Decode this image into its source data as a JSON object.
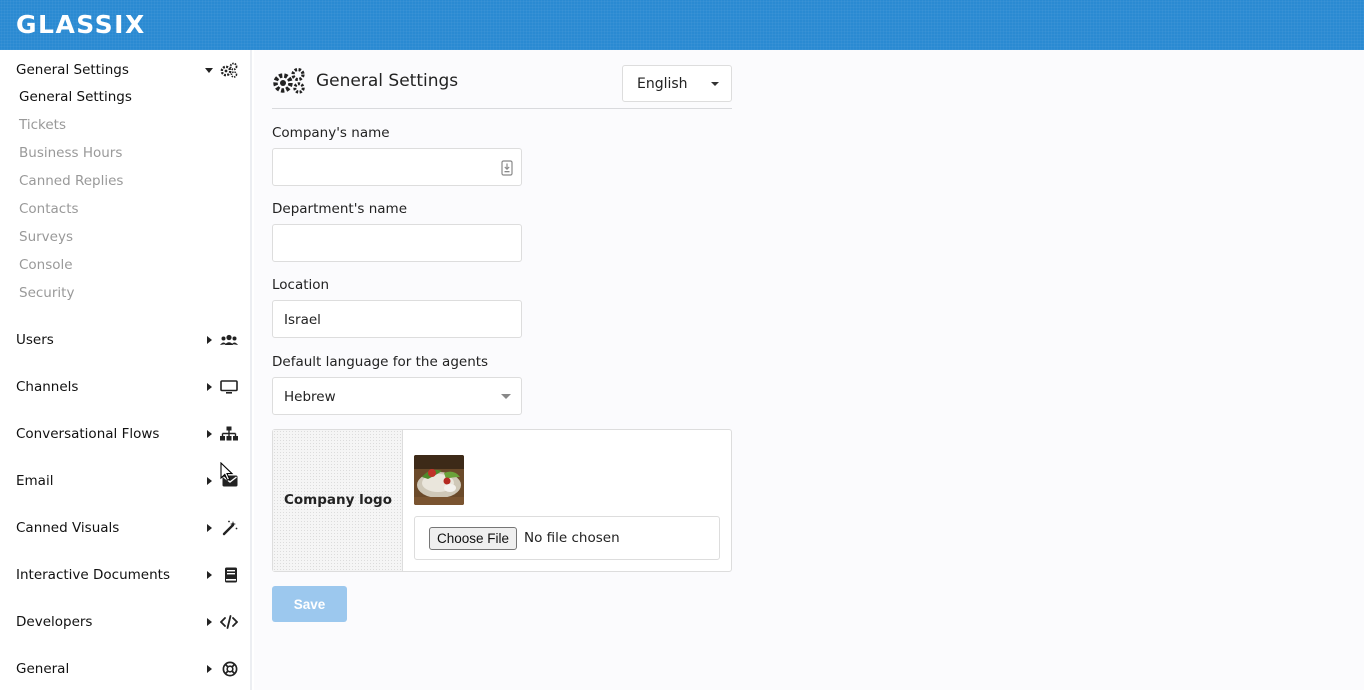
{
  "app": {
    "brand": "GLASSIX"
  },
  "sidebar": {
    "top_section": {
      "label": "General Settings",
      "icon": "gears-icon",
      "items": [
        {
          "label": "General Settings",
          "active": true
        },
        {
          "label": "Tickets"
        },
        {
          "label": "Business Hours"
        },
        {
          "label": "Canned Replies"
        },
        {
          "label": "Contacts"
        },
        {
          "label": "Surveys"
        },
        {
          "label": "Console"
        },
        {
          "label": "Security"
        }
      ]
    },
    "sections": [
      {
        "label": "Users",
        "icon": "users-icon"
      },
      {
        "label": "Channels",
        "icon": "monitor-icon"
      },
      {
        "label": "Conversational Flows",
        "icon": "sitemap-icon"
      },
      {
        "label": "Email",
        "icon": "envelope-icon"
      },
      {
        "label": "Canned Visuals",
        "icon": "magic-wand-icon"
      },
      {
        "label": "Interactive Documents",
        "icon": "book-icon"
      },
      {
        "label": "Developers",
        "icon": "code-icon"
      },
      {
        "label": "General",
        "icon": "life-ring-icon"
      }
    ]
  },
  "main": {
    "title": "General Settings",
    "language_select": {
      "value": "English"
    },
    "fields": {
      "company_name": {
        "label": "Company's name",
        "value": ""
      },
      "department_name": {
        "label": "Department's name",
        "value": ""
      },
      "location": {
        "label": "Location",
        "value": "Israel"
      },
      "default_language": {
        "label": "Default language for the agents",
        "value": "Hebrew"
      }
    },
    "logo": {
      "label": "Company logo",
      "choose_button": "Choose File",
      "file_status": "No file chosen"
    },
    "save_label": "Save"
  },
  "colors": {
    "topbar": "#2a8ad2",
    "save_button": "#9cc8ee"
  }
}
